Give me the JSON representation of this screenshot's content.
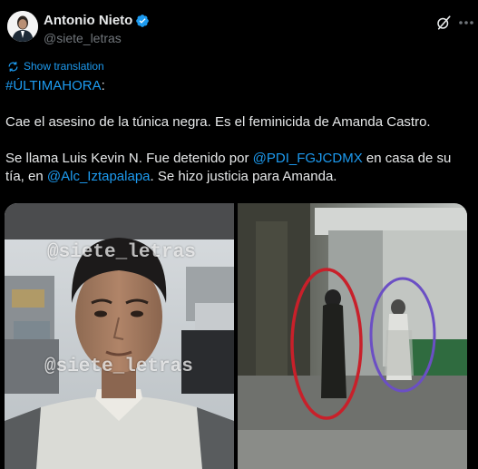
{
  "author": {
    "display_name": "Antonio Nieto",
    "handle": "@siete_letras",
    "verified": true,
    "verified_color": "#1d9bf0"
  },
  "actions": {
    "grok_icon": "grok-icon",
    "more_icon": "more-options-icon"
  },
  "translate": {
    "label": "Show translation",
    "icon": "translate-icon"
  },
  "tweet": {
    "hashtag": "#ÚLTIMAHORA",
    "hashtag_suffix": ":",
    "line2": "Cae el asesino de la túnica negra. Es el feminicida de Amanda Castro.",
    "line3_part1": "Se llama Luis Kevin N. Fue detenido por ",
    "mention1": "@PDI_FGJCDMX",
    "line3_part2": " en casa de su tía, en ",
    "mention2": "@Alc_Iztapalapa",
    "line3_part3": ". Se hizo justicia para Amanda."
  },
  "media": {
    "watermark_top": "@siete_letras",
    "watermark_bottom": "@siete_letras"
  },
  "colors": {
    "background": "#000000",
    "text": "#e7e9ea",
    "secondary": "#71767b",
    "link": "#1d9bf0",
    "circle_red": "#c8202a",
    "circle_purple": "#6b4fc4"
  }
}
